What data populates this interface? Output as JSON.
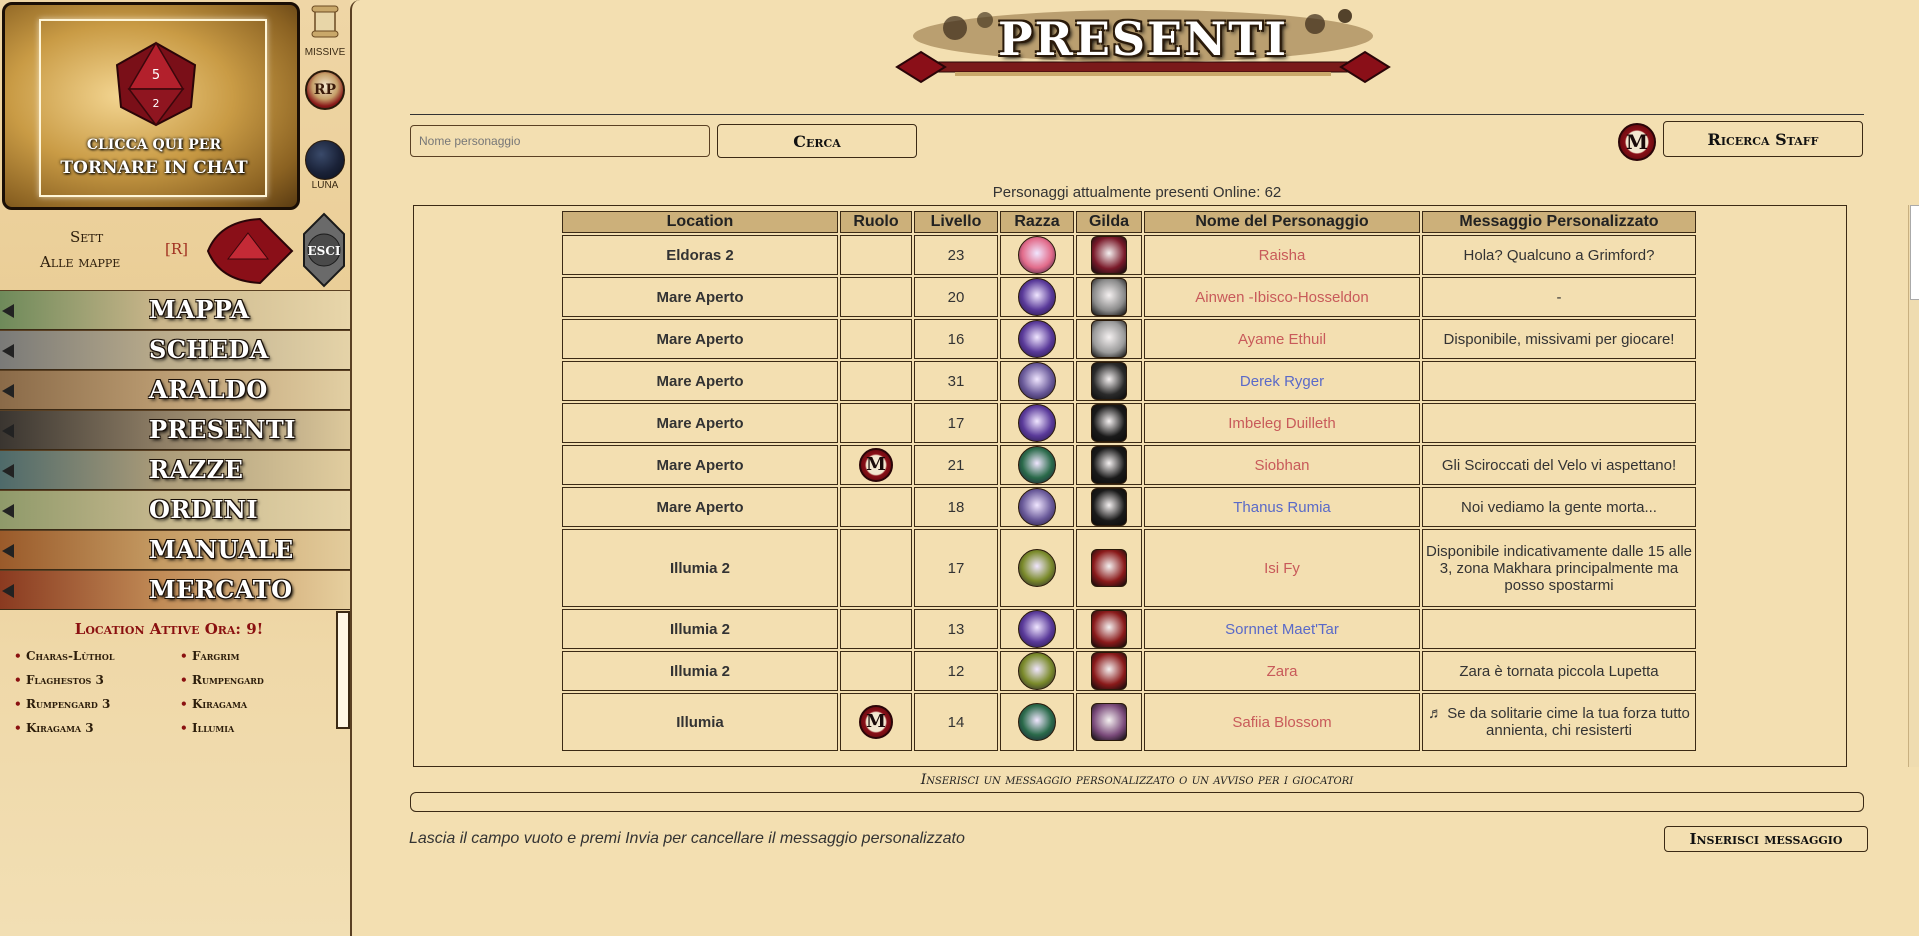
{
  "chat_banner": {
    "line1": "CLICCA QUI PER",
    "line2": "TORNARE IN CHAT"
  },
  "side_icons": {
    "missive": "MISSIVE",
    "luna": "LUNA",
    "rp_badge": "RP",
    "esci": "ESCI"
  },
  "sett": {
    "line1": "Sett",
    "line2": "Alle mappe",
    "r": "[R]"
  },
  "menu": [
    {
      "label": "MAPPA",
      "colors": [
        "#6e8a5a",
        "#c9b58a",
        "#e8d6aa"
      ]
    },
    {
      "label": "SCHEDA",
      "colors": [
        "#7a7a78",
        "#b8aa8a",
        "#e5d3a8"
      ]
    },
    {
      "label": "ARALDO",
      "colors": [
        "#8a6a48",
        "#b99a70",
        "#e2cfa3"
      ]
    },
    {
      "label": "PRESENTI",
      "colors": [
        "#3a3530",
        "#8c7c64",
        "#ddc99c"
      ]
    },
    {
      "label": "RAZZE",
      "colors": [
        "#4e6a6a",
        "#a99a78",
        "#e1cd9f"
      ]
    },
    {
      "label": "ORDINI",
      "colors": [
        "#8f9a6a",
        "#c4b68c",
        "#e6d4a8"
      ]
    },
    {
      "label": "MANUALE",
      "colors": [
        "#9a5a2a",
        "#c49a62",
        "#e3cc9c"
      ]
    },
    {
      "label": "MERCATO",
      "colors": [
        "#8a3a20",
        "#c08a55",
        "#e6cf9e"
      ]
    }
  ],
  "locations": {
    "title": "Location Attive Ora: 9!",
    "col1": [
      "Charas-Lùthol",
      "Flaghestos 3",
      "Rumpengard 3",
      "Kiragama 3"
    ],
    "col2": [
      "Fargrim",
      "Rumpengard",
      "Kiragama",
      "Illumia"
    ]
  },
  "page_title": "PRESENTI",
  "search": {
    "placeholder": "Nome personaggio",
    "button": "Cerca",
    "staff_button": "Ricerca Staff",
    "staff_badge": "M"
  },
  "online_text": "Personaggi attualmente presenti Online: 62",
  "table": {
    "headers": [
      "Location",
      "Ruolo",
      "Livello",
      "Razza",
      "Gilda",
      "Nome del Personaggio",
      "Messaggio Personalizzato"
    ],
    "rows": [
      {
        "location": "Eldoras 2",
        "role": "",
        "level": "23",
        "race_color": "#e26b8a",
        "guild_color": "#7a1a2a",
        "name": "Raisha",
        "name_color": "#c85a5a",
        "message": "Hola? Qualcuno a Grimford?",
        "h": 38
      },
      {
        "location": "Mare Aperto",
        "role": "",
        "level": "20",
        "race_color": "#5a3a9a",
        "guild_color": "#8a8a8a",
        "name": "Ainwen -Ibisco-Hosseldon",
        "name_color": "#c85a5a",
        "message": "-",
        "h": 38
      },
      {
        "location": "Mare Aperto",
        "role": "",
        "level": "16",
        "race_color": "#5a3a9a",
        "guild_color": "#9a9a9a",
        "name": "Ayame Ethuil",
        "name_color": "#c85a5a",
        "message": "Disponibile, missivami per giocare!",
        "h": 38
      },
      {
        "location": "Mare Aperto",
        "role": "",
        "level": "31",
        "race_color": "#6a5a9a",
        "guild_color": "#2a2a2a",
        "name": "Derek Ryger",
        "name_color": "#5a6ac8",
        "message": "",
        "h": 38
      },
      {
        "location": "Mare Aperto",
        "role": "",
        "level": "17",
        "race_color": "#5a3a9a",
        "guild_color": "#1a1a1a",
        "name": "Imbeleg Duilleth",
        "name_color": "#c85a5a",
        "message": "",
        "h": 38
      },
      {
        "location": "Mare Aperto",
        "role": "M",
        "level": "21",
        "race_color": "#2a6a4a",
        "guild_color": "#1a1a1a",
        "name": "Siobhan",
        "name_color": "#c85a5a",
        "message": "Gli Sciroccati del Velo vi aspettano!",
        "h": 38
      },
      {
        "location": "Mare Aperto",
        "role": "",
        "level": "18",
        "race_color": "#6a5a9a",
        "guild_color": "#1a1a1a",
        "name": "Thanus Rumia",
        "name_color": "#5a6ac8",
        "message": "Noi vediamo la gente morta...",
        "h": 38
      },
      {
        "location": "Illumia 2",
        "role": "",
        "level": "17",
        "race_color": "#7a8a2a",
        "guild_color": "#8a1a1a",
        "name": "Isi Fy",
        "name_color": "#c85a5a",
        "message": "Disponibile indicativamente dalle 15 alle 3, zona Makhara principalmente ma posso spostarmi",
        "h": 78
      },
      {
        "location": "Illumia 2",
        "role": "",
        "level": "13",
        "race_color": "#5a3a9a",
        "guild_color": "#8a1a1a",
        "name": "Sornnet Maet'Tar",
        "name_color": "#5a6ac8",
        "message": "",
        "h": 38
      },
      {
        "location": "Illumia 2",
        "role": "",
        "level": "12",
        "race_color": "#7a8a2a",
        "guild_color": "#8a1a1a",
        "name": "Zara",
        "name_color": "#c85a5a",
        "message": "Zara è tornata piccola Lupetta",
        "h": 38
      },
      {
        "location": "Illumia",
        "role": "M",
        "level": "14",
        "race_color": "#2a6a4a",
        "guild_color": "#7a4a7a",
        "name": "Safiia Blossom",
        "name_color": "#c85a5a",
        "message": "♬ Se da solitarie cime la tua forza tutto annienta, chi resisterti",
        "h": 58
      }
    ]
  },
  "message_box": {
    "caption": "Inserisci un messaggio personalizzato o un avviso per i giocatori",
    "hint": "Lascia il campo vuoto e premi Invia per cancellare il messaggio personalizzato",
    "button": "Inserisci messaggio"
  }
}
